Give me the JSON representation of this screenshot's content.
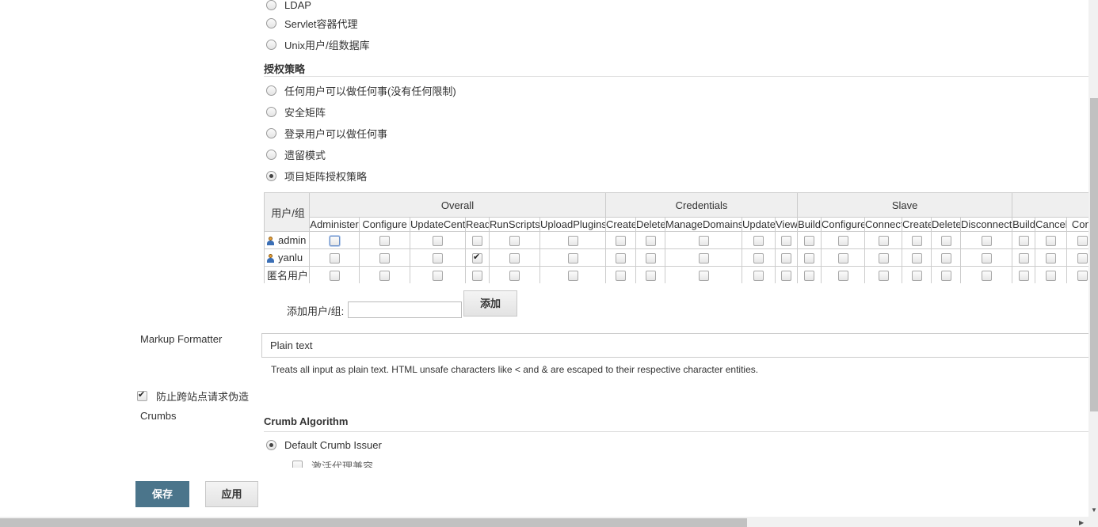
{
  "security_realm": {
    "options": [
      "LDAP",
      "Servlet容器代理",
      "Unix用户/组数据库"
    ]
  },
  "authorization": {
    "title": "授权策略",
    "options": [
      {
        "label": "任何用户可以做任何事(没有任何限制)",
        "selected": false
      },
      {
        "label": "安全矩阵",
        "selected": false
      },
      {
        "label": "登录用户可以做任何事",
        "selected": false
      },
      {
        "label": "遗留模式",
        "selected": false
      },
      {
        "label": "项目矩阵授权策略",
        "selected": true
      }
    ]
  },
  "matrix": {
    "user_group_header": "用户/组",
    "groups": [
      {
        "name": "Overall",
        "permissions": [
          "Administer",
          "Configure",
          "UpdateCenter",
          "Read",
          "RunScripts",
          "UploadPlugins"
        ]
      },
      {
        "name": "Credentials",
        "permissions": [
          "Create",
          "Delete",
          "ManageDomains",
          "Update",
          "View"
        ]
      },
      {
        "name": "Slave",
        "permissions": [
          "Build",
          "Configure",
          "Connect",
          "Create",
          "Delete",
          "Disconnect"
        ]
      },
      {
        "name": "",
        "permissions": [
          "Build",
          "Cancel",
          "Conf"
        ]
      }
    ],
    "rows": [
      {
        "name": "admin",
        "user_icon": "user-icon",
        "checked": [],
        "focused": [
          0
        ]
      },
      {
        "name": "yanlu",
        "user_icon": "user-icon",
        "checked": [
          3
        ],
        "focused": []
      },
      {
        "name": "匿名用户",
        "user_icon": "",
        "checked": [],
        "focused": []
      }
    ]
  },
  "add_user": {
    "label": "添加用户/组:",
    "value": "",
    "button": "添加"
  },
  "markup_formatter": {
    "label": "Markup Formatter",
    "selected": "Plain text",
    "help": "Treats all input as plain text. HTML unsafe characters like < and & are escaped to their respective character entities."
  },
  "csrf": {
    "checkbox_label": "防止跨站点请求伪造",
    "checked": true,
    "crumbs_label": "Crumbs",
    "crumb_algorithm_title": "Crumb Algorithm",
    "issuer_option": "Default Crumb Issuer",
    "issuer_selected": true,
    "proxy_compat_label": "激活代理兼容"
  },
  "footer": {
    "save": "保存",
    "apply": "应用"
  },
  "colors": {
    "primary_button": "#4b758b",
    "table_header_bg": "#efefef",
    "border": "#cccccc"
  }
}
